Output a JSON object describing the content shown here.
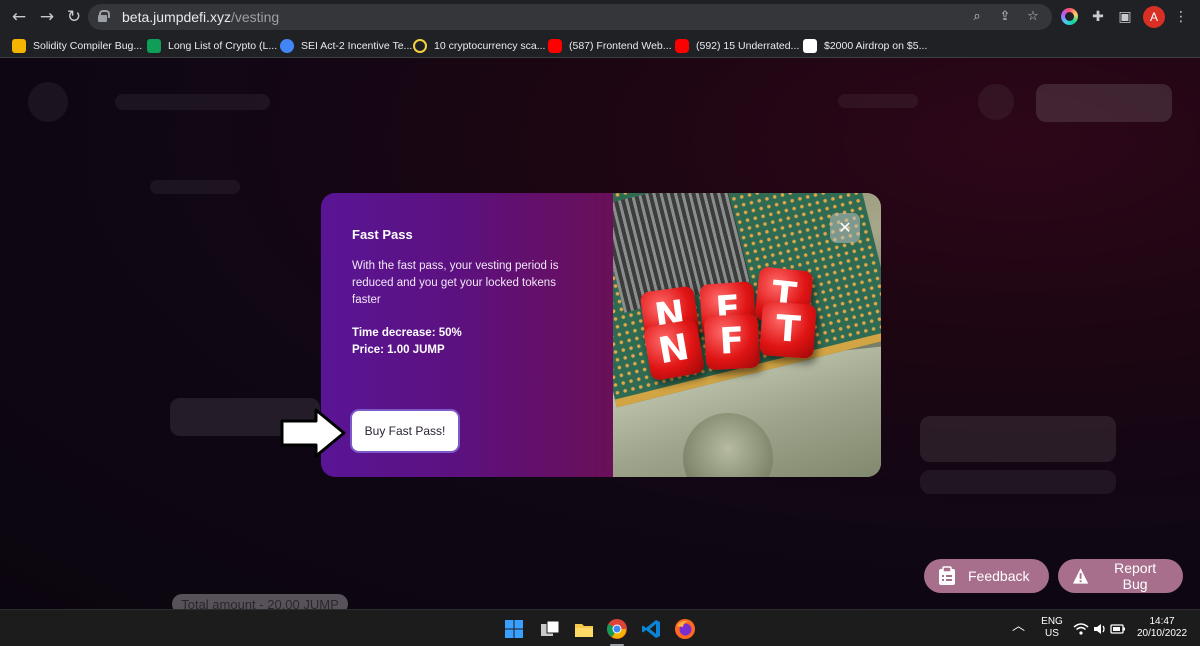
{
  "browser": {
    "url_host": "beta.jumpdefi.xyz",
    "url_path": "/vesting",
    "avatar_letter": "A",
    "bookmarks": [
      {
        "label": "Solidity Compiler Bug...",
        "icon_color": "#f4b400"
      },
      {
        "label": "Long List of Crypto (L...",
        "icon_color": "#0f9d58"
      },
      {
        "label": "SEI Act-2 Incentive Te...",
        "icon_color": "#4285f4"
      },
      {
        "label": "10 cryptocurrency sca...",
        "icon_color": "#f4d03f"
      },
      {
        "label": "(587) Frontend Web...",
        "icon_color": "#ff0000"
      },
      {
        "label": "(592) 15 Underrated...",
        "icon_color": "#ff0000"
      },
      {
        "label": "$2000 Airdrop on $5...",
        "icon_color": "#ffffff"
      }
    ]
  },
  "background": {
    "total_amount_label": "Total amount - 20.00 JUMP"
  },
  "modal": {
    "title": "Fast Pass",
    "description": "With the fast pass, your vesting period is reduced and you get your locked tokens faster",
    "time_decrease": "Time decrease: 50%",
    "price": "Price: 1.00 JUMP",
    "buy_button": "Buy Fast Pass!",
    "close_glyph": "✕",
    "image_letters": [
      "N",
      "F",
      "T",
      "N",
      "F",
      "T"
    ]
  },
  "floating": {
    "feedback_label": "Feedback",
    "report_label": "Report Bug"
  },
  "taskbar": {
    "lang_top": "ENG",
    "lang_bottom": "US",
    "time": "14:47",
    "date": "20/10/2022"
  },
  "colors": {
    "modal_left_start": "#5a1596",
    "modal_left_end": "#6a0f58",
    "floating_button": "#a86f8d",
    "browser_chrome": "#202124"
  }
}
